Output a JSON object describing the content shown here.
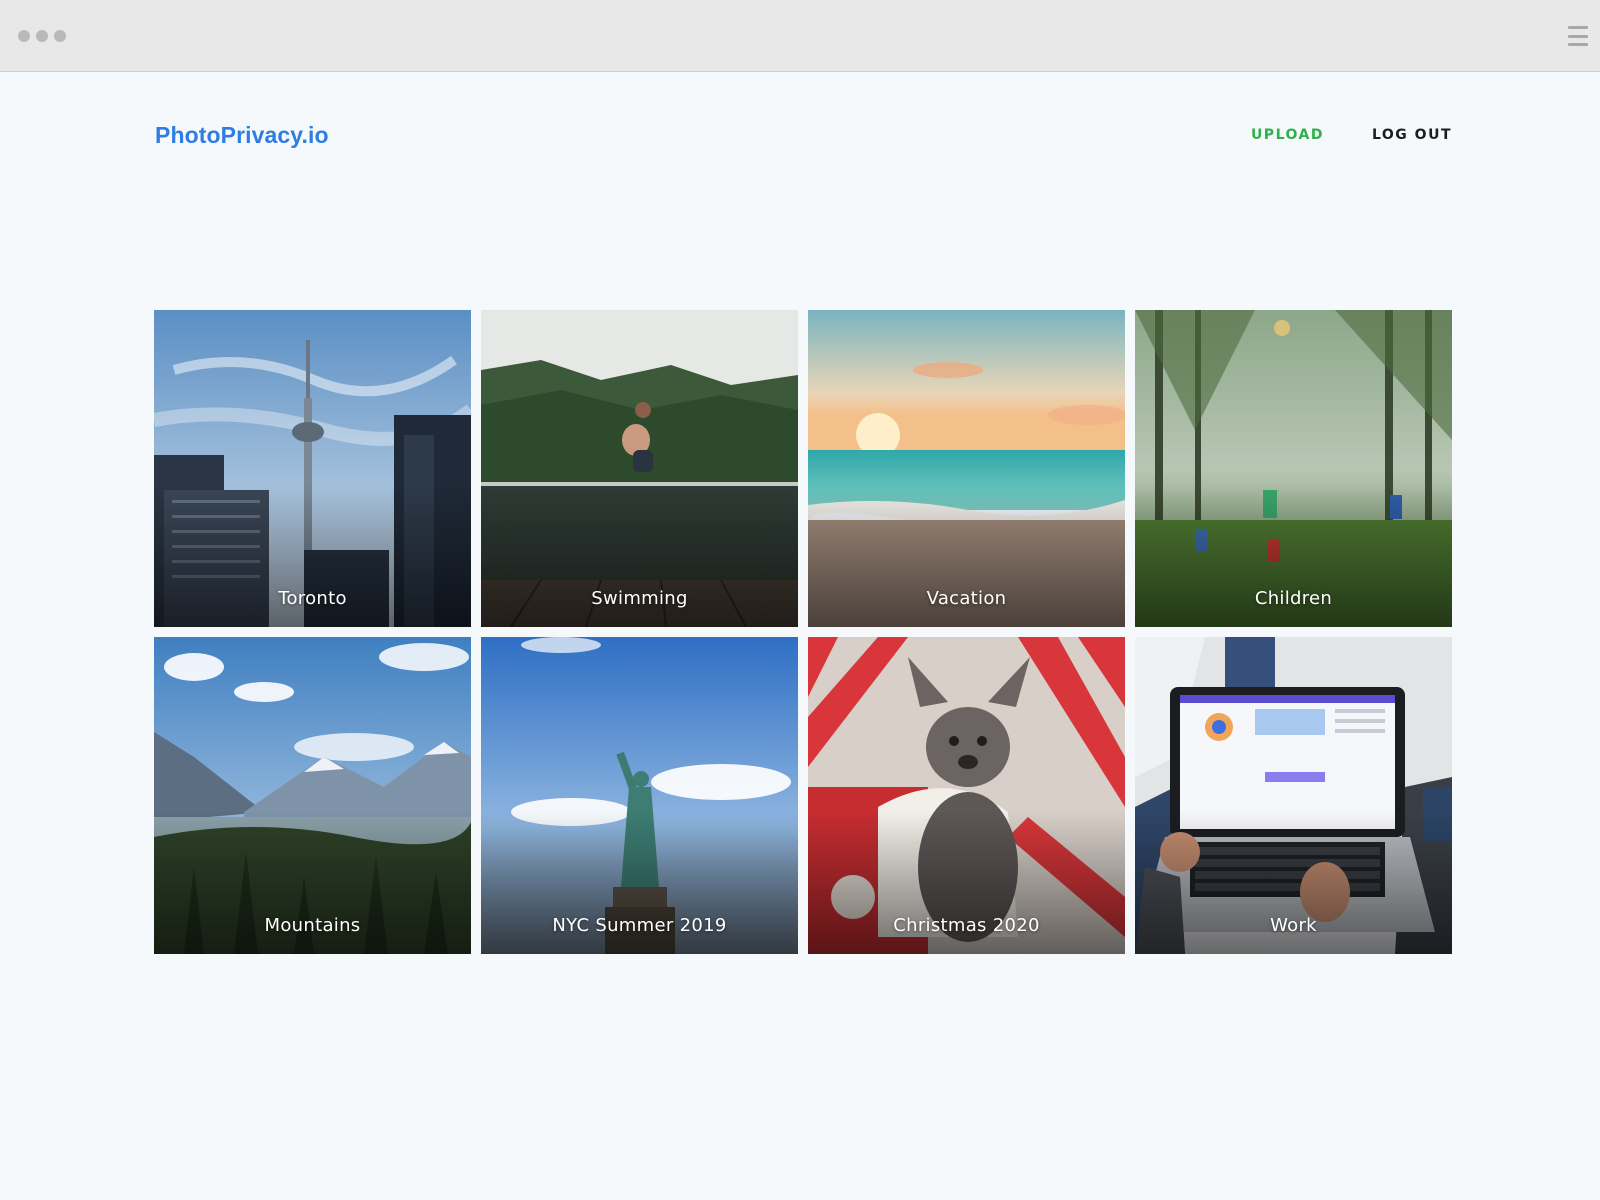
{
  "brand": {
    "name": "PhotoPrivacy.io",
    "color": "#2f7de1"
  },
  "nav": {
    "upload_label": "UPLOAD",
    "upload_color": "#2bb24c",
    "logout_label": "LOG OUT"
  },
  "albums": [
    {
      "title": "Toronto",
      "scene": "city-tower-icon"
    },
    {
      "title": "Swimming",
      "scene": "lake-jump-icon"
    },
    {
      "title": "Vacation",
      "scene": "beach-sunset-icon"
    },
    {
      "title": "Children",
      "scene": "forest-kids-icon"
    },
    {
      "title": "Mountains",
      "scene": "mountain-valley-icon"
    },
    {
      "title": "NYC Summer 2019",
      "scene": "statue-of-liberty-icon"
    },
    {
      "title": "Christmas 2020",
      "scene": "puppy-gift-icon"
    },
    {
      "title": "Work",
      "scene": "laptop-icon"
    }
  ]
}
